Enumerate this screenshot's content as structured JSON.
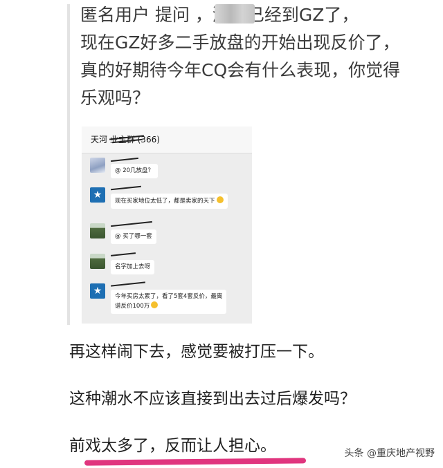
{
  "question": {
    "lines": [
      "匿名用户  提问                ，潮水已经到GZ了，",
      "现在GZ好多二手放盘的开始出现反价了，",
      "真的好期待今年CQ会有什么表现，你觉得",
      "乐观吗？"
    ]
  },
  "chat": {
    "group_title": "天河       业主群 (366)",
    "messages": [
      {
        "avatar": "snow-avatar",
        "text": "@            20几放盘？"
      },
      {
        "avatar": "star-avatar",
        "text": "现在买家地位太低了，都是卖家的天下"
      },
      {
        "avatar": "landscape-avatar",
        "text": "@        买了哪一套"
      },
      {
        "avatar": "landscape-avatar",
        "text": "名字加上去呀"
      },
      {
        "avatar": "star-avatar",
        "text_line1": "今年买房太累了，看了5套4套反价，最离",
        "text_line2": "谱反价100万"
      }
    ]
  },
  "paragraphs": [
    "再这样闹下去，感觉要被打压一下。",
    "这种潮水不应该直接到出去过后爆发吗？",
    "前戏太多了，反而让人担心。"
  ],
  "watermark": "头条 @重庆地产视野",
  "colors": {
    "underline": "#e0357e",
    "quote_bar": "#e3e3e3"
  }
}
